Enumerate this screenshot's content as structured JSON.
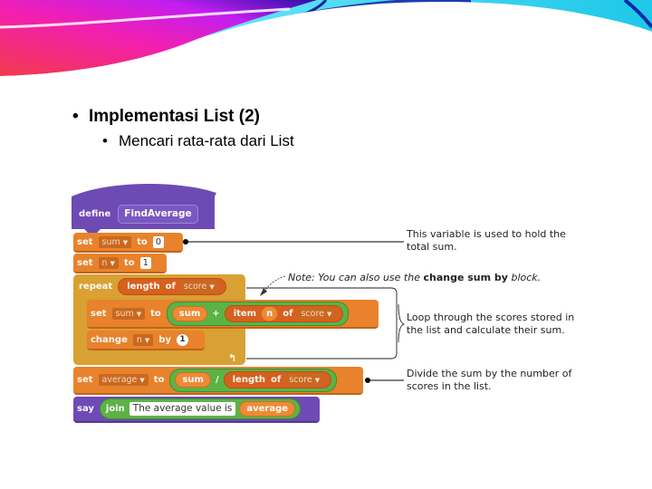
{
  "slide": {
    "heading": "Implementasi List (2)",
    "subheading": "Mencari rata-rata dari List",
    "bullet": "•"
  },
  "script": {
    "define": {
      "keyword": "define",
      "name": "FindAverage"
    },
    "set_sum": {
      "keyword": "set",
      "var": "sum",
      "to": "to",
      "value": "0"
    },
    "set_n": {
      "keyword": "set",
      "var": "n",
      "to": "to",
      "value": "1"
    },
    "repeat": {
      "keyword": "repeat",
      "length_kw": "length",
      "of_kw": "of",
      "list": "score"
    },
    "inner_set": {
      "keyword": "set",
      "var": "sum",
      "to": "to",
      "left": "sum",
      "op": "+",
      "item_kw": "item",
      "index": "n",
      "of_kw": "of",
      "list": "score"
    },
    "change": {
      "keyword": "change",
      "var": "n",
      "by": "by",
      "value": "1"
    },
    "set_avg": {
      "keyword": "set",
      "var": "average",
      "to": "to",
      "left": "sum",
      "op": "/",
      "length_kw": "length",
      "of_kw": "of",
      "list": "score"
    },
    "say": {
      "keyword": "say",
      "join_kw": "join",
      "text": "The average value is",
      "var": "average"
    },
    "dropdown_glyph": "▼",
    "loop_arrow": "↰"
  },
  "annotations": {
    "sum_note_line1": "This variable is used to hold the",
    "sum_note_line2": "total sum.",
    "tip_prefix": "Note: You can also use the ",
    "tip_bold": "change sum by",
    "tip_suffix": " block.",
    "loop_note_line1": "Loop through the scores stored in",
    "loop_note_line2": "the list and calculate their sum.",
    "divide_note_line1": "Divide the sum by the number of",
    "divide_note_line2": "scores in the list."
  },
  "colors": {
    "motion_orange": "#e8822c",
    "control_gold": "#d9a033",
    "custom_purple": "#6e4ab5",
    "operator_green": "#5cb345"
  }
}
